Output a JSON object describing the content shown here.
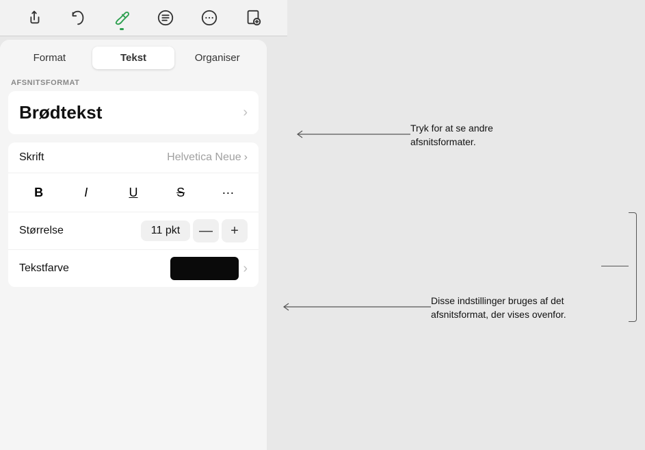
{
  "toolbar": {
    "icons": [
      {
        "name": "share-icon",
        "label": "Share"
      },
      {
        "name": "undo-icon",
        "label": "Undo"
      },
      {
        "name": "paintbrush-icon",
        "label": "Paintbrush",
        "active": true
      },
      {
        "name": "list-icon",
        "label": "List"
      },
      {
        "name": "more-icon",
        "label": "More"
      },
      {
        "name": "document-icon",
        "label": "Document"
      }
    ]
  },
  "tabs": [
    {
      "id": "format",
      "label": "Format"
    },
    {
      "id": "tekst",
      "label": "Tekst",
      "active": true
    },
    {
      "id": "organiser",
      "label": "Organiser"
    }
  ],
  "section_label": "AFSNITSFORMAT",
  "paragraph_format": {
    "name": "Brødtekst",
    "chevron": "›"
  },
  "font": {
    "label": "Skrift",
    "value": "Helvetica Neue",
    "chevron": "›"
  },
  "style_buttons": [
    {
      "id": "bold",
      "label": "B",
      "class": "bold"
    },
    {
      "id": "italic",
      "label": "I",
      "class": "italic"
    },
    {
      "id": "underline",
      "label": "U",
      "class": "underline"
    },
    {
      "id": "strikethrough",
      "label": "S",
      "class": "strikethrough"
    },
    {
      "id": "more",
      "label": "···",
      "class": "dots-btn"
    }
  ],
  "size": {
    "label": "Størrelse",
    "value": "11 pkt",
    "minus": "—",
    "plus": "+"
  },
  "text_color": {
    "label": "Tekstfarve",
    "swatch_color": "#0a0a0a",
    "chevron": "›"
  },
  "callout1": {
    "text": "Tryk for at se andre afsnitsformater."
  },
  "callout2": {
    "text": "Disse indstillinger bruges af det afsnitsformat, der vises ovenfor."
  }
}
